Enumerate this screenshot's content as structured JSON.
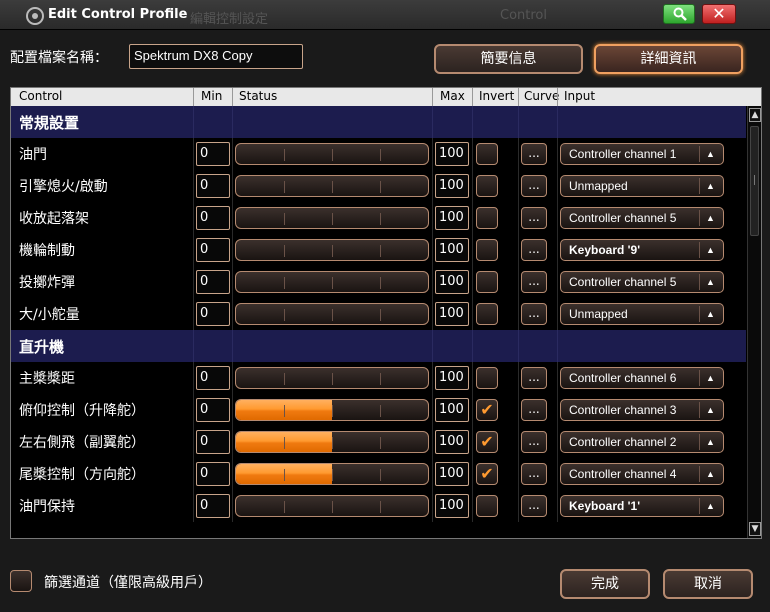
{
  "window": {
    "title": "Edit Control Profile",
    "ghost_title_left": "編輯控制設定",
    "ghost_title_right": "Control"
  },
  "colors": {
    "accent": "#ff9a30",
    "section_bg": "#1c1c4e",
    "border": "#b58a70"
  },
  "profile": {
    "name_label": "配置檔案名稱：",
    "name_value": "Spektrum DX8 Copy",
    "summary_button": "簡要信息",
    "detail_button": "詳細資訊"
  },
  "columns": {
    "control": "Control",
    "min": "Min",
    "status": "Status",
    "max": "Max",
    "invert": "Invert",
    "curve": "Curve",
    "input": "Input"
  },
  "rows": [
    {
      "type": "section",
      "label": "常規設置"
    },
    {
      "type": "control",
      "label": "油門",
      "min": "0",
      "max": "100",
      "fill": 0,
      "inverted": false,
      "curve": "...",
      "input": "Controller channel 1",
      "bold_input": false
    },
    {
      "type": "control",
      "label": "引擎熄火/啟動",
      "min": "0",
      "max": "100",
      "fill": 0,
      "inverted": false,
      "curve": "...",
      "input": "Unmapped",
      "bold_input": false
    },
    {
      "type": "control",
      "label": "收放起落架",
      "min": "0",
      "max": "100",
      "fill": 0,
      "inverted": false,
      "curve": "...",
      "input": "Controller channel 5",
      "bold_input": false
    },
    {
      "type": "control",
      "label": "機輪制動",
      "min": "0",
      "max": "100",
      "fill": 0,
      "inverted": false,
      "curve": "...",
      "input": "Keyboard '9'",
      "bold_input": true
    },
    {
      "type": "control",
      "label": "投擲炸彈",
      "min": "0",
      "max": "100",
      "fill": 0,
      "inverted": false,
      "curve": "...",
      "input": "Controller channel 5",
      "bold_input": false
    },
    {
      "type": "control",
      "label": "大/小舵量",
      "min": "0",
      "max": "100",
      "fill": 0,
      "inverted": false,
      "curve": "...",
      "input": "Unmapped",
      "bold_input": false
    },
    {
      "type": "section",
      "label": "直升機"
    },
    {
      "type": "control",
      "label": "主槳槳距",
      "min": "0",
      "max": "100",
      "fill": 0,
      "inverted": false,
      "curve": "...",
      "input": "Controller channel 6",
      "bold_input": false
    },
    {
      "type": "control",
      "label": "俯仰控制（升降舵）",
      "min": "0",
      "max": "100",
      "fill": 0.5,
      "inverted": true,
      "curve": "...",
      "input": "Controller channel 3",
      "bold_input": false
    },
    {
      "type": "control",
      "label": "左右側飛（副翼舵）",
      "min": "0",
      "max": "100",
      "fill": 0.5,
      "inverted": true,
      "curve": "...",
      "input": "Controller channel 2",
      "bold_input": false
    },
    {
      "type": "control",
      "label": "尾槳控制（方向舵）",
      "min": "0",
      "max": "100",
      "fill": 0.5,
      "inverted": true,
      "curve": "...",
      "input": "Controller channel 4",
      "bold_input": false
    },
    {
      "type": "control",
      "label": "油門保持",
      "min": "0",
      "max": "100",
      "fill": 0,
      "inverted": false,
      "curve": "...",
      "input": "Keyboard '1'",
      "bold_input": true
    }
  ],
  "scrollbar": {
    "up": "▲",
    "down": "▼"
  },
  "footer": {
    "filter_label": "篩選通道（僅限高級用戶）",
    "ok_button": "完成",
    "cancel_button": "取消"
  }
}
